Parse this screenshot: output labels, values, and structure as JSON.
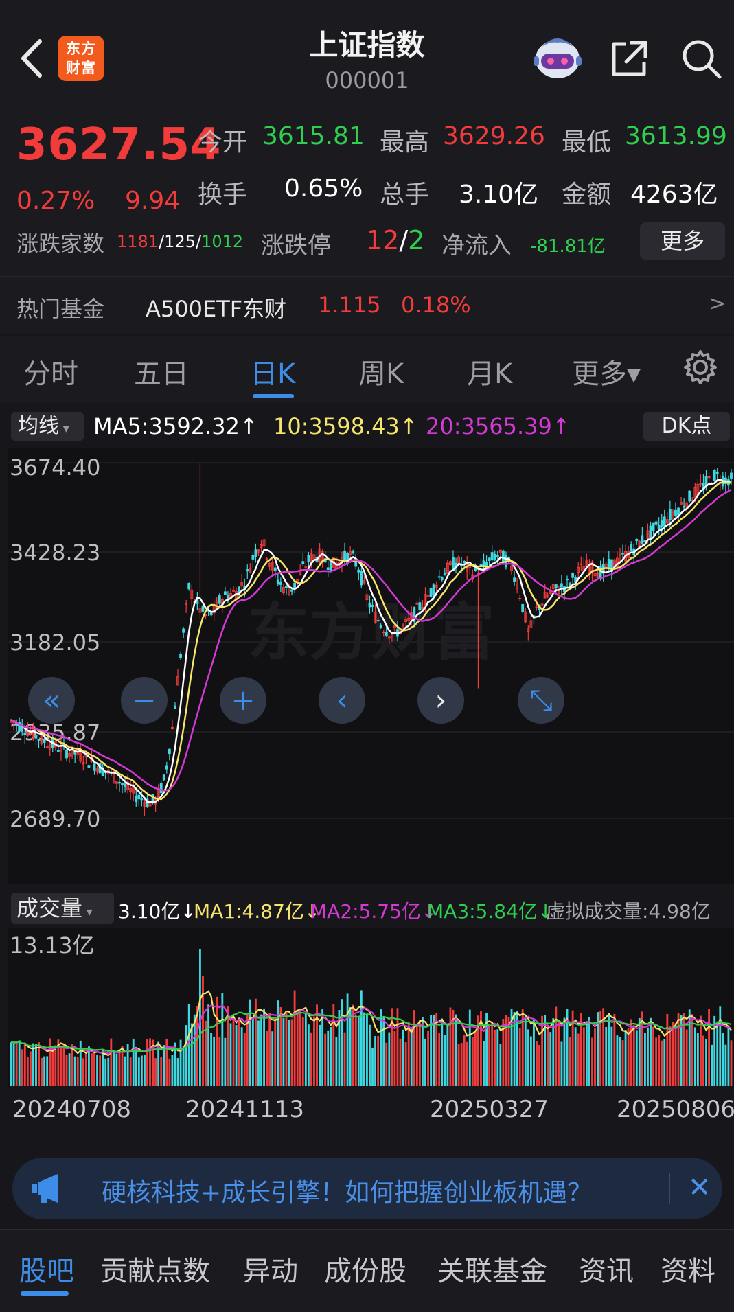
{
  "header": {
    "title": "上证指数",
    "code": "000001",
    "logo_line1": "东方",
    "logo_line2": "财富"
  },
  "quote": {
    "price": "3627.54",
    "change_pct": "0.27%",
    "change": "9.94",
    "open_label": "今开",
    "open": "3615.81",
    "high_label": "最高",
    "high": "3629.26",
    "low_label": "最低",
    "low": "3613.99",
    "turnover_label": "换手",
    "turnover": "0.65%",
    "volume_label": "总手",
    "volume": "3.10亿",
    "amount_label": "金额",
    "amount": "4263亿",
    "breadth_label": "涨跌家数",
    "breadth_up": "1181",
    "breadth_flat": "125",
    "breadth_down": "1012",
    "breadth_sep": "/",
    "limit_label": "涨跌停",
    "limit_up": "12",
    "limit_down": "2",
    "limit_sep": "/",
    "netflow_label": "净流入",
    "netflow": "-81.81亿",
    "more_label": "更多"
  },
  "hot_fund": {
    "label": "热门基金",
    "name": "A500ETF东财",
    "price": "1.115",
    "pct": "0.18%",
    "arrow": ">"
  },
  "tabs": [
    {
      "label": "分时"
    },
    {
      "label": "五日"
    },
    {
      "label": "日K"
    },
    {
      "label": "周K"
    },
    {
      "label": "月K"
    },
    {
      "label": "更多▾"
    }
  ],
  "ma_legend": {
    "select": "均线",
    "ma5": "MA5:3592.32↑",
    "ma10": "10:3598.43↑",
    "ma20": "20:3565.39↑",
    "dk_label": "DK点"
  },
  "chart_axis": {
    "y_labels": [
      "3674.40",
      "3428.23",
      "3182.05",
      "2935.87",
      "2689.70"
    ],
    "vol_max_label": "13.13亿",
    "dates": [
      "20240708",
      "20241113",
      "20250327",
      "20250806"
    ]
  },
  "vol_legend": {
    "select": "成交量",
    "vol": "3.10亿↓",
    "ma1": "MA1:4.87亿↓",
    "ma2": "MA2:5.75亿↓",
    "ma3": "MA3:5.84亿↓",
    "virtual": "虚拟成交量:4.98亿"
  },
  "ad": {
    "text": "硬核科技+成长引擎！如何把握创业板机遇？"
  },
  "bottom_tabs": [
    {
      "label": "股吧"
    },
    {
      "label": "贡献点数"
    },
    {
      "label": "异动"
    },
    {
      "label": "成份股"
    },
    {
      "label": "关联基金"
    },
    {
      "label": "资讯"
    },
    {
      "label": "资料"
    }
  ],
  "watermark": "东方财富",
  "colors": {
    "up": "#f23c3c",
    "down": "#3fd8e0",
    "ma5": "#ffffff",
    "ma10": "#f5e56a",
    "ma20": "#d33ad3",
    "accent": "#3d8de8"
  },
  "chart_data": {
    "type": "candlestick",
    "ylim": [
      2689.7,
      3674.4
    ],
    "x_start": "20240708",
    "x_end": "20250806",
    "close_trend": [
      2960,
      2950,
      2935,
      2920,
      2905,
      2895,
      2885,
      2875,
      2870,
      2858,
      2845,
      2830,
      2815,
      2800,
      2780,
      2760,
      2745,
      2735,
      2740,
      2800,
      2950,
      3150,
      3330,
      3280,
      3250,
      3260,
      3300,
      3310,
      3320,
      3350,
      3420,
      3460,
      3400,
      3350,
      3320,
      3330,
      3380,
      3410,
      3420,
      3400,
      3390,
      3410,
      3420,
      3380,
      3300,
      3250,
      3220,
      3200,
      3210,
      3230,
      3260,
      3290,
      3320,
      3360,
      3380,
      3400,
      3390,
      3370,
      3380,
      3400,
      3420,
      3410,
      3380,
      3300,
      3200,
      3270,
      3300,
      3320,
      3330,
      3340,
      3370,
      3390,
      3380,
      3370,
      3390,
      3400,
      3420,
      3440,
      3460,
      3480,
      3500,
      3520,
      3540,
      3560,
      3580,
      3600,
      3620,
      3640,
      3630,
      3627
    ],
    "volume_max": "13.13亿"
  }
}
